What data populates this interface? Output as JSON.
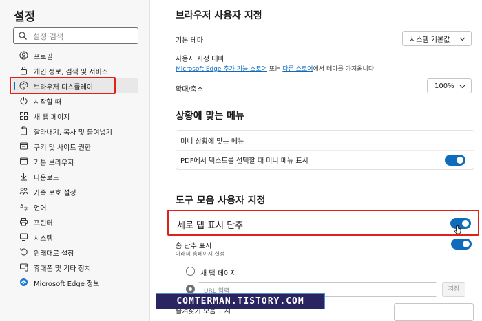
{
  "sidebar": {
    "title": "설정",
    "search_placeholder": "설정 검색",
    "items": [
      {
        "label": "프로필",
        "icon": "profile-icon"
      },
      {
        "label": "개인 정보, 검색 및 서비스",
        "icon": "lock-icon"
      },
      {
        "label": "브라우저 디스플레이",
        "icon": "palette-icon",
        "selected": true
      },
      {
        "label": "시작할 때",
        "icon": "power-icon"
      },
      {
        "label": "새 탭 페이지",
        "icon": "grid-icon"
      },
      {
        "label": "잘라내기, 복사 및 붙여넣기",
        "icon": "clipboard-icon"
      },
      {
        "label": "쿠키 및 사이트 권한",
        "icon": "cookie-icon"
      },
      {
        "label": "기본 브라우저",
        "icon": "browser-icon"
      },
      {
        "label": "다운로드",
        "icon": "download-icon"
      },
      {
        "label": "가족 보호 설정",
        "icon": "family-icon"
      },
      {
        "label": "언어",
        "icon": "language-icon"
      },
      {
        "label": "프린터",
        "icon": "printer-icon"
      },
      {
        "label": "시스템",
        "icon": "system-icon"
      },
      {
        "label": "원래대로 설정",
        "icon": "reset-icon"
      },
      {
        "label": "휴대폰 및 기타 장치",
        "icon": "phone-icon"
      },
      {
        "label": "Microsoft Edge 정보",
        "icon": "edge-icon"
      }
    ]
  },
  "main": {
    "section1": {
      "title": "브라우저 사용자 지정",
      "default_theme_label": "기본 테마",
      "default_theme_value": "시스템 기본값",
      "custom_theme_label": "사용자 지정 테마",
      "custom_theme_link1": "Microsoft Edge 추가 기능 스토어",
      "custom_theme_mid": " 또는 ",
      "custom_theme_link2": "다른 스토어",
      "custom_theme_tail": "에서 테마를 가져옵니다.",
      "zoom_label": "확대/축소",
      "zoom_value": "100%"
    },
    "section2": {
      "title": "상황에 맞는 메뉴",
      "row1": "미니 상황에 맞는 메뉴",
      "row2": "PDF에서 텍스트를 선택할 때 미니 메뉴 표시",
      "row2_toggle": true
    },
    "section3": {
      "title": "도구 모음 사용자 지정",
      "vertical_tabs_label": "세로 탭 표시 단추",
      "vertical_tabs_toggle": true,
      "home_label": "홈 단추 표시",
      "home_sub": "아래의 홈페이지 설정",
      "home_toggle": true,
      "radio_newtab": "새 탭 페이지",
      "url_placeholder": "URL 입력",
      "save_label": "저장",
      "favorites_label": "즐겨찾기 모음 표시"
    }
  },
  "watermark": "COMTERMAN.TISTORY.COM",
  "colors": {
    "accent": "#0f6cbd",
    "highlight": "#e0201b",
    "watermark_bg": "#2a2460"
  }
}
